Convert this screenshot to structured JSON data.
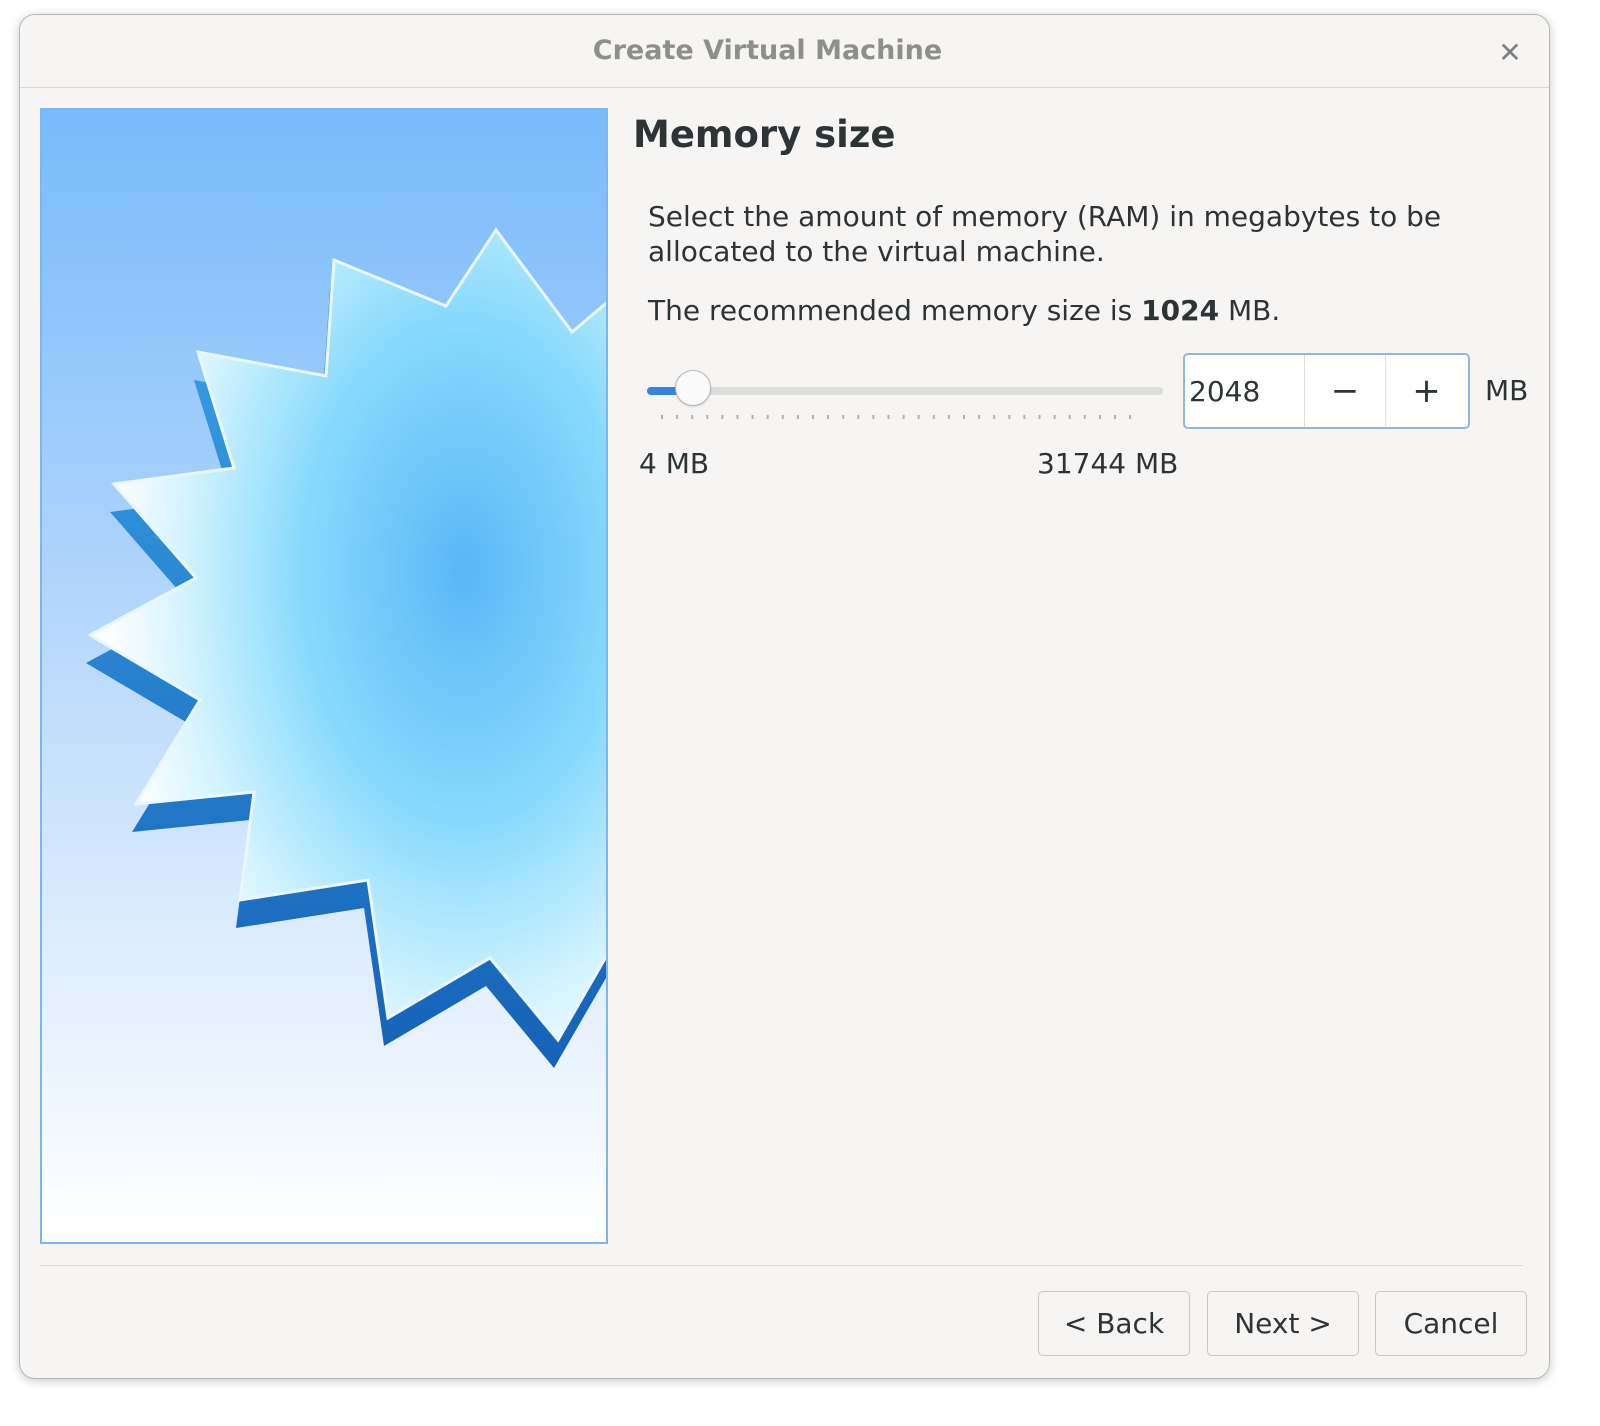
{
  "window": {
    "title": "Create Virtual Machine",
    "close_icon": "close-icon"
  },
  "page": {
    "title": "Memory size",
    "description": "Select the amount of memory (RAM) in megabytes to be allocated to the virtual machine.",
    "recommend_prefix": "The recommended memory size is ",
    "recommend_value": "1024",
    "recommend_suffix": " MB."
  },
  "memory": {
    "value": "2048",
    "unit": "MB",
    "min_label": "4 MB",
    "max_label": "31744 MB",
    "min": 4,
    "max": 31744,
    "slider_value": 2048
  },
  "spin": {
    "decrement_label": "−",
    "increment_label": "+"
  },
  "buttons": {
    "back": "< Back",
    "next": "Next >",
    "cancel": "Cancel"
  },
  "colors": {
    "accent": "#3584e4",
    "focus_border": "#8fb6e4",
    "image_border": "#7cb6f0"
  }
}
